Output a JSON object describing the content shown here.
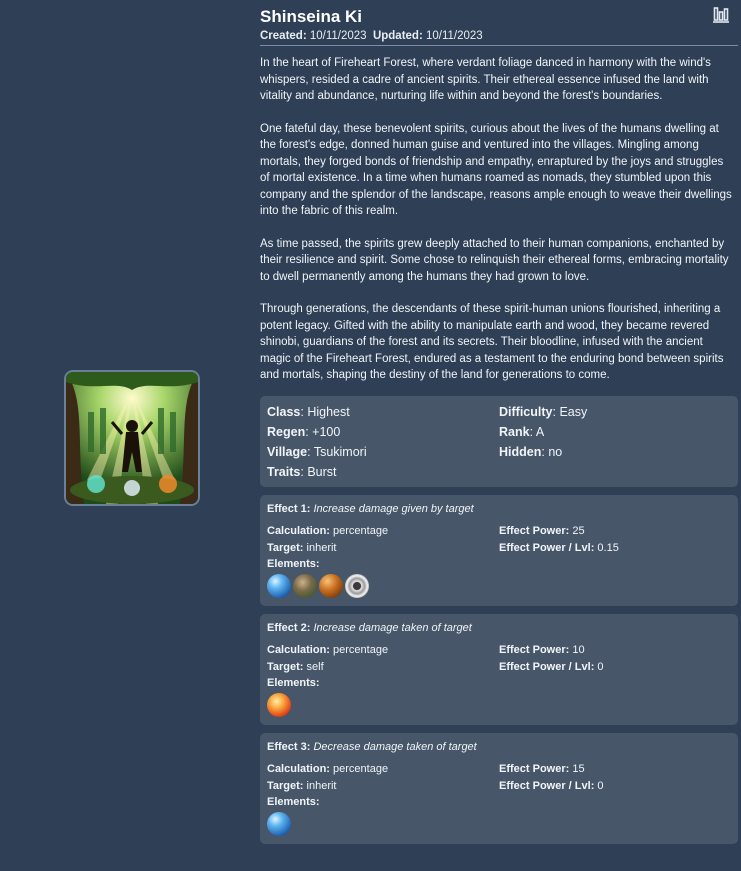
{
  "header": {
    "title": "Shinseina Ki",
    "created_label": "Created:",
    "created_value": "10/11/2023",
    "updated_label": "Updated:",
    "updated_value": "10/11/2023",
    "stats_icon": "bar-chart-icon"
  },
  "description": [
    "In the heart of Fireheart Forest, where verdant foliage danced in harmony with the wind's whispers, resided a cadre of ancient spirits. Their ethereal essence infused the land with vitality and abundance, nurturing life within and beyond the forest's boundaries.",
    "One fateful day, these benevolent spirits, curious about the lives of the humans dwelling at the forest's edge, donned human guise and ventured into the villages. Mingling among mortals, they forged bonds of friendship and empathy, enraptured by the joys and struggles of mortal existence. In a time when humans roamed as nomads, they stumbled upon this company and the splendor of the landscape, reasons ample enough to weave their dwellings into the fabric of this realm.",
    "As time passed, the spirits grew deeply attached to their human companions, enchanted by their resilience and spirit. Some chose to relinquish their ethereal forms, embracing mortality to dwell permanently among the humans they had grown to love.",
    "Through generations, the descendants of these spirit-human unions flourished, inheriting a potent legacy. Gifted with the ability to manipulate earth and wood, they became revered shinobi, guardians of the forest and its secrets. Their bloodline, infused with the ancient magic of the Fireheart Forest, endured as a testament to the enduring bond between spirits and mortals, shaping the destiny of the land for generations to come."
  ],
  "info": {
    "class_label": "Class",
    "class_value": "Highest",
    "difficulty_label": "Difficulty",
    "difficulty_value": "Easy",
    "regen_label": "Regen",
    "regen_value": "+100",
    "rank_label": "Rank",
    "rank_value": "A",
    "village_label": "Village",
    "village_value": "Tsukimori",
    "hidden_label": "Hidden",
    "hidden_value": "no",
    "traits_label": "Traits",
    "traits_value": "Burst"
  },
  "labels": {
    "calculation": "Calculation:",
    "target": "Target:",
    "effect_power": "Effect Power:",
    "effect_power_lvl": "Effect Power / Lvl:",
    "elements": "Elements:"
  },
  "effects": [
    {
      "label": "Effect 1:",
      "name": "Increase damage given by target",
      "calculation": "percentage",
      "target": "inherit",
      "power": "25",
      "power_lvl": "0.15",
      "elements": [
        "water-orb-icon",
        "earth-orb-icon",
        "wood-orb-icon",
        "metal-ring-icon"
      ]
    },
    {
      "label": "Effect 2:",
      "name": "Increase damage taken of target",
      "calculation": "percentage",
      "target": "self",
      "power": "10",
      "power_lvl": "0",
      "elements": [
        "fire-orb-icon"
      ]
    },
    {
      "label": "Effect 3:",
      "name": "Decrease damage taken of target",
      "calculation": "percentage",
      "target": "inherit",
      "power": "15",
      "power_lvl": "0",
      "elements": [
        "water-orb-icon"
      ]
    }
  ],
  "colors": {
    "background": "#2f3f55",
    "card": "#475669",
    "text": "#f1f5f9"
  }
}
